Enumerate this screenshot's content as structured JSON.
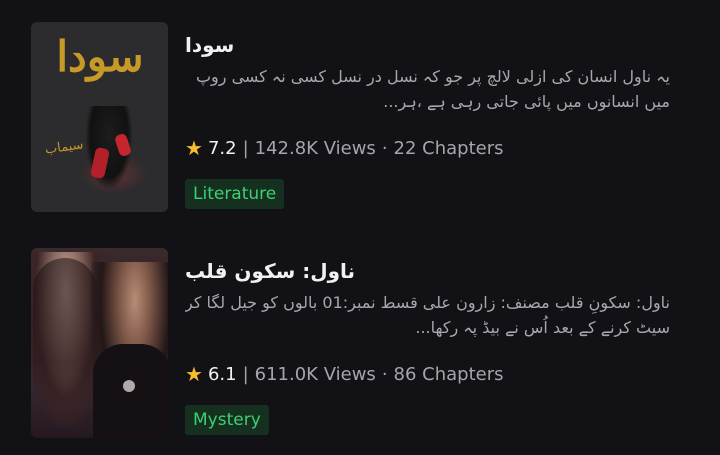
{
  "books": [
    {
      "title": "سودا",
      "cover_title": "سودا",
      "cover_signature": "سیماب",
      "description": "یہ ناول انسان کی ازلی لالچ پر جو کہ نسل در نسل کسی نہ کسی روپ میں انسانوں میں پائی جاتی رہی ہے ،ہر...",
      "rating": "7.2",
      "views": "142.8K Views",
      "chapters": "22 Chapters",
      "tag": "Literature",
      "tag_color": "#3fcf74"
    },
    {
      "title": "ناول: سکون قلب",
      "description": "ناول: سکونِ قلب مصنف: زارون علی قسط نمبر:01 بالوں کو جیل لگا کر سیٹ کرنے کے بعد اُس نے بیڈ پہ رکھا...",
      "rating": "6.1",
      "views": "611.0K Views",
      "chapters": "86 Chapters",
      "tag": "Mystery",
      "tag_color": "#3fcf74"
    }
  ],
  "icons": {
    "rating": "star-icon"
  },
  "colors": {
    "background": "#121115",
    "star": "#f4bf2a",
    "tag_bg": "#15301f"
  },
  "separators": {
    "pipe": "|",
    "dot": "·"
  }
}
